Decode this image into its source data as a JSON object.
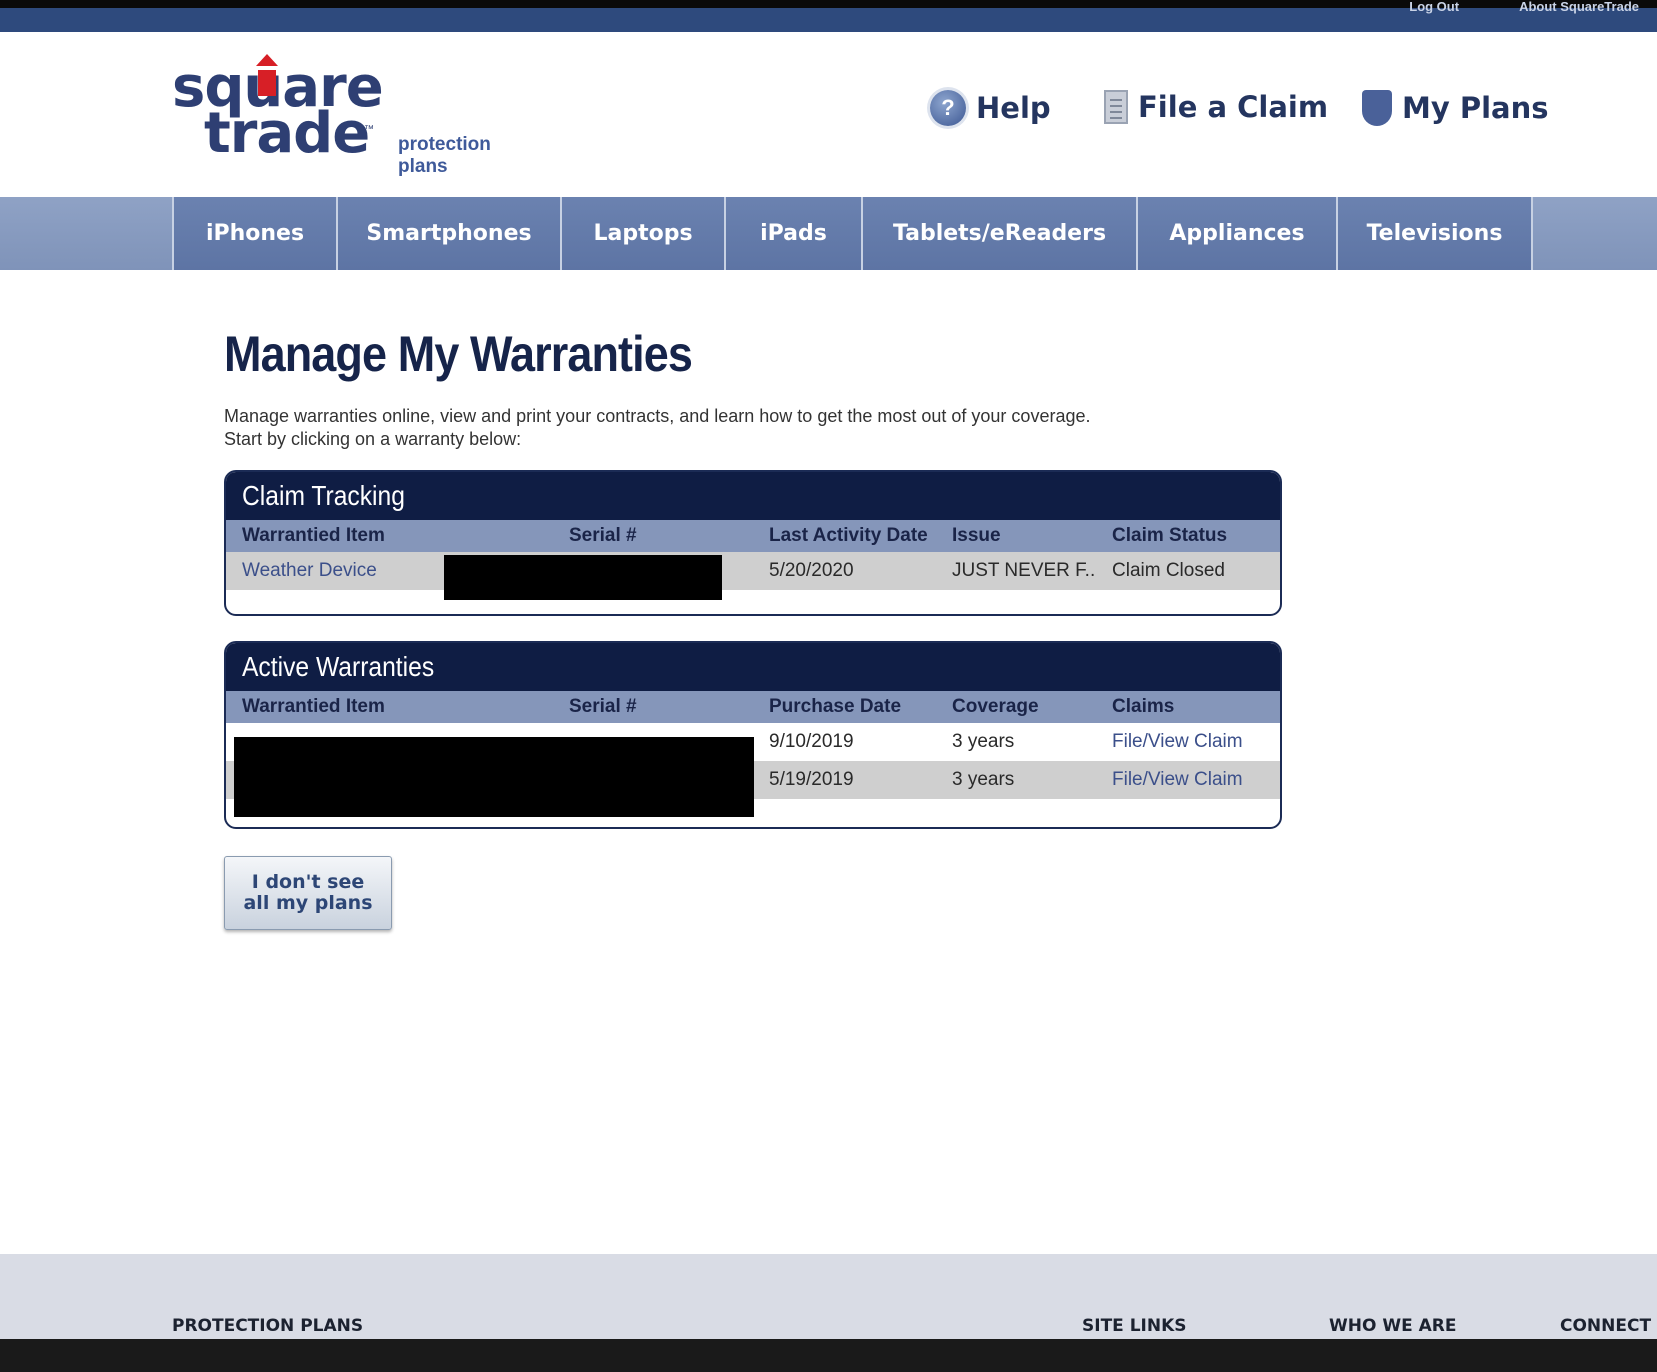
{
  "topbar": {
    "links": [
      "Log Out",
      "About SquareTrade"
    ]
  },
  "header": {
    "logo": {
      "line1": "square",
      "line2": "trade",
      "tagline_line1": "protection",
      "tagline_line2": "plans"
    },
    "utility_links": [
      {
        "label": "Help",
        "icon": "help-icon"
      },
      {
        "label": "File a Claim",
        "icon": "document-icon"
      },
      {
        "label": "My Plans",
        "icon": "shield-icon"
      }
    ]
  },
  "nav": {
    "items": [
      "iPhones",
      "Smartphones",
      "Laptops",
      "iPads",
      "Tablets/eReaders",
      "Appliances",
      "Televisions"
    ]
  },
  "main": {
    "title": "Manage My Warranties",
    "intro_line1": "Manage warranties online, view and print your contracts, and learn how to get the most out of your coverage.",
    "intro_line2": "Start by clicking on a warranty below:"
  },
  "claim_tracking": {
    "title": "Claim Tracking",
    "columns": [
      "Warrantied Item",
      "Serial #",
      "Last Activity Date",
      "Issue",
      "Claim Status"
    ],
    "rows": [
      {
        "item": "Weather Device",
        "serial": "",
        "date": "5/20/2020",
        "issue": "JUST NEVER F...",
        "status": "Claim Closed"
      }
    ]
  },
  "active_warranties": {
    "title": "Active Warranties",
    "columns": [
      "Warrantied Item",
      "Serial #",
      "Purchase Date",
      "Coverage",
      "Claims"
    ],
    "rows": [
      {
        "item": "",
        "serial": "",
        "date": "9/10/2019",
        "coverage": "3 years",
        "claims": "File/View Claim"
      },
      {
        "item": "",
        "serial": "",
        "date": "5/19/2019",
        "coverage": "3 years",
        "claims": "File/View Claim"
      }
    ]
  },
  "missing_plans_button": {
    "line1": "I don't see",
    "line2": "all my plans"
  },
  "footer": {
    "headings": [
      "PROTECTION PLANS",
      "SITE LINKS",
      "WHO WE ARE",
      "CONNECT W"
    ]
  },
  "colors": {
    "brand_navy": "#0f1d44",
    "nav_blue": "#6b82b0",
    "logo_red": "#d71f26",
    "link_blue": "#3b4f8a"
  }
}
